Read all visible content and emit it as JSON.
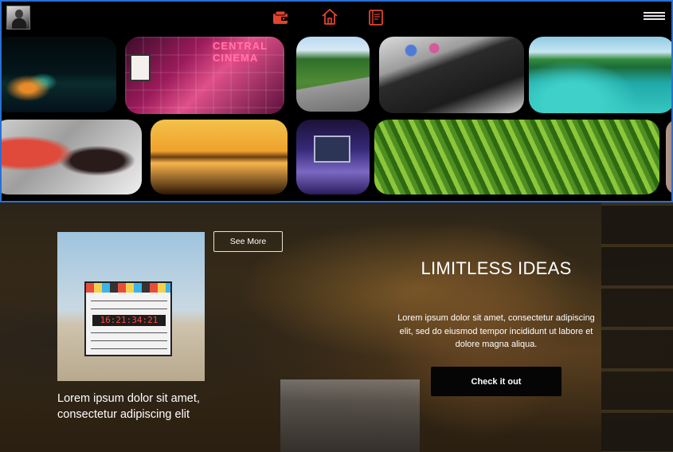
{
  "nav": {
    "avatar_icon": "user-avatar",
    "icons": [
      "wallet-icon",
      "home-icon",
      "book-icon",
      "menu-icon"
    ],
    "accent_color": "#e0442e"
  },
  "gallery": {
    "tiles": [
      {
        "subject": "city-night"
      },
      {
        "subject": "cinema",
        "sign_line1": "CENTRAL",
        "sign_line2": "CINEMA"
      },
      {
        "subject": "road"
      },
      {
        "subject": "desk"
      },
      {
        "subject": "tropical-resort"
      },
      {
        "subject": "film-crew"
      },
      {
        "subject": "sunset-beach"
      },
      {
        "subject": "laptop-coding"
      },
      {
        "subject": "palm-leaf"
      }
    ]
  },
  "hero": {
    "feature_caption": "Lorem ipsum dolor sit amet, consectetur adipiscing elit",
    "see_more_label": "See More",
    "title": "LIMITLESS IDEAS",
    "body": "Lorem ipsum dolor sit amet, consectetur adipiscing elit, sed do eiusmod tempor incididunt ut labore et dolore magna aliqua.",
    "cta_label": "Check it out",
    "clapper_digits": "16:21:34:21"
  },
  "colors": {
    "frame_border": "#2a6fd6",
    "icon_accent": "#e0442e"
  }
}
